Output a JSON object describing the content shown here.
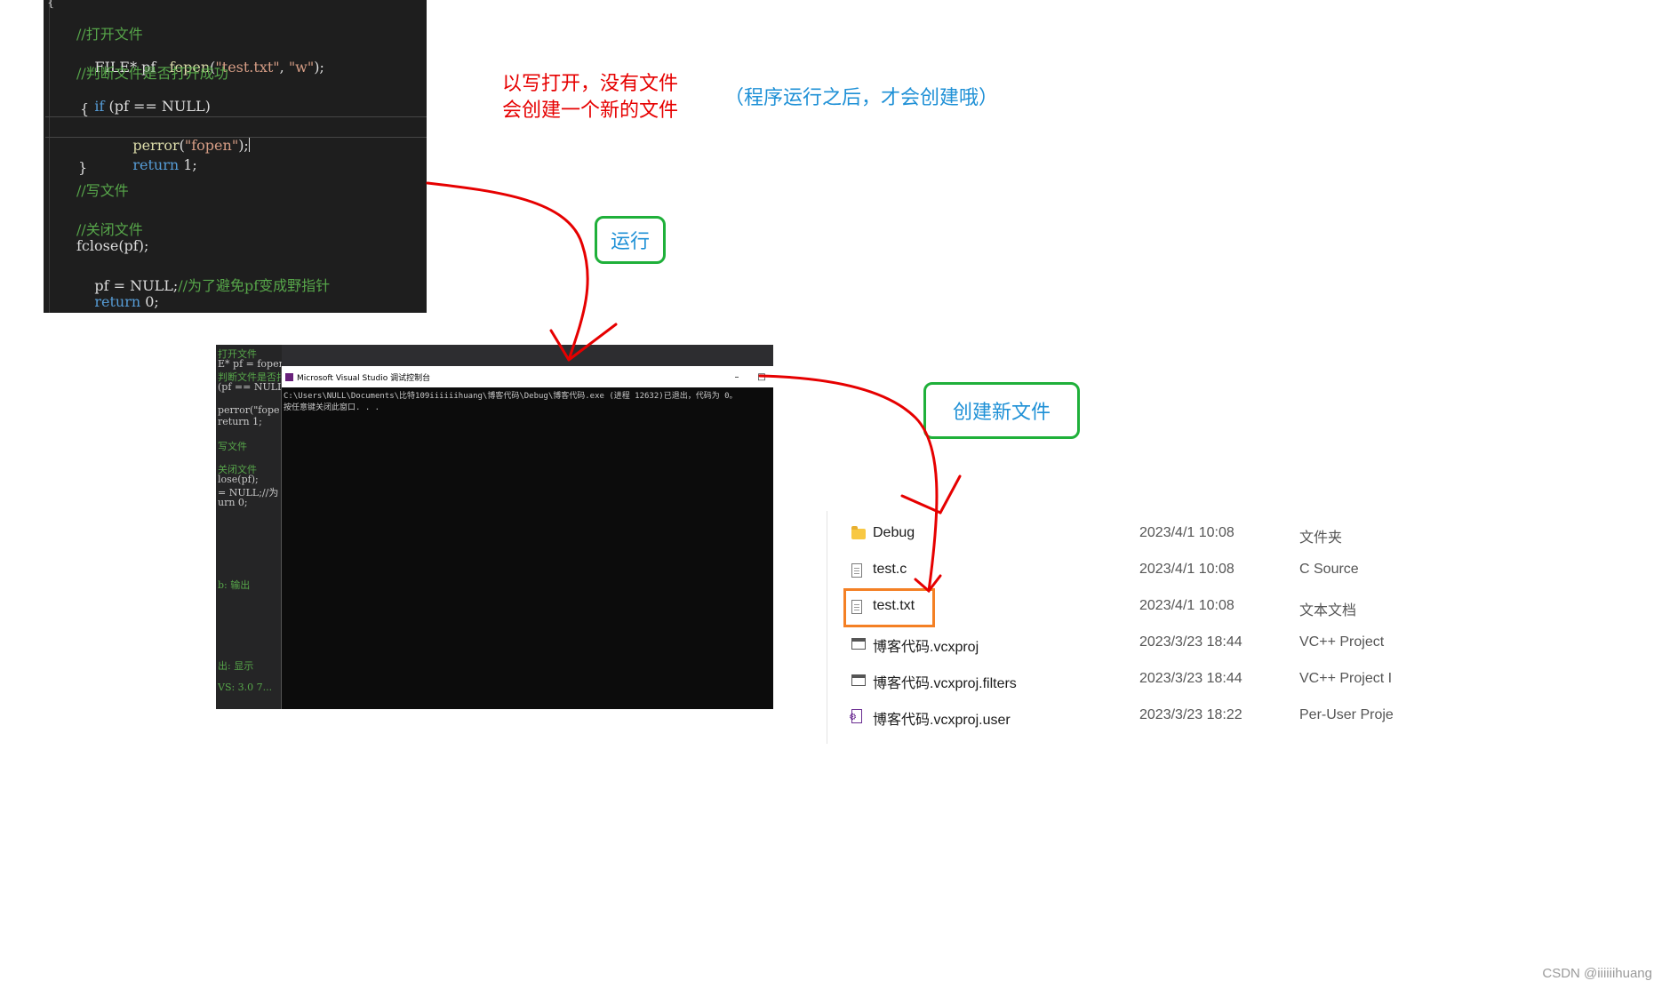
{
  "editor": {
    "brace_open": "{",
    "lines": [
      {
        "cls": "cm",
        "text": "//打开文件"
      },
      {
        "cls": "mixed_fopen"
      },
      {
        "cls": "cm",
        "text": "//判断文件是否打开成功"
      },
      {
        "cls": "mixed_if"
      },
      {
        "cls": "plain",
        "text": "{"
      },
      {
        "cls": "mixed_perror"
      },
      {
        "cls": "mixed_return1"
      },
      {
        "cls": "plain",
        "text": "}"
      },
      {
        "cls": "cm",
        "text": "//写文件"
      },
      {
        "cls": "cm",
        "text": "//关闭文件"
      },
      {
        "cls": "plain",
        "text": "fclose(pf);"
      },
      {
        "cls": "mixed_null"
      },
      {
        "cls": "mixed_return0"
      }
    ],
    "fopen_line": {
      "a": "FILE* pf   ",
      "fn": "fopen",
      "b": "(",
      "str1": "\"test.txt\"",
      "c": ", ",
      "str2": "\"w\"",
      "d": ");"
    },
    "if_line": {
      "kw": "if",
      "rest": " (pf == NULL)"
    },
    "perror_line": {
      "fn": "perror",
      "a": "(",
      "str": "\"fopen\"",
      "b": ");"
    },
    "return1_line": {
      "kw": "return",
      "rest": " 1;"
    },
    "null_line": {
      "a": "pf = NULL;",
      "cm": "//为了避免pf变成野指针"
    },
    "return0_line": {
      "kw": "return",
      "rest": " 0;"
    }
  },
  "annotations": {
    "red_line1": "以写打开，没有文件",
    "red_line2": "会创建一个新的文件",
    "blue_note": "（程序运行之后，才会创建哦）",
    "run_label": "运行",
    "create_label": "创建新文件"
  },
  "console": {
    "bg_code": [
      "打开文件",
      "E* pf = fopen",
      "判断文件是否打",
      "(pf == NULL)",
      "",
      "perror(\"fope",
      "return 1;",
      "",
      "写文件",
      "",
      "关闭文件",
      "lose(pf);",
      "= NULL;//为",
      "urn 0;",
      "",
      "",
      "",
      "",
      "",
      "",
      "b: 输出",
      "",
      "",
      "",
      "",
      "",
      "",
      "出: 显示",
      "",
      "VS: 3.0 7..."
    ],
    "title": "Microsoft Visual Studio 调试控制台",
    "minimize": "–",
    "maximize": "□",
    "output_line1": "C:\\Users\\NULL\\Documents\\比特109iiiiiihuang\\博客代码\\Debug\\博客代码.exe (进程 12632)已退出，代码为 0。",
    "output_line2": "按任意键关闭此窗口. . ."
  },
  "explorer": {
    "files": [
      {
        "icon": "folder-icon",
        "name": "Debug",
        "date": "2023/4/1 10:08",
        "type": "文件夹"
      },
      {
        "icon": "c-source-icon",
        "name": "test.c",
        "date": "2023/4/1 10:08",
        "type": "C Source"
      },
      {
        "icon": "text-document-icon",
        "name": "test.txt",
        "date": "2023/4/1 10:08",
        "type": "文本文档"
      },
      {
        "icon": "vcxproj-icon",
        "name": "博客代码.vcxproj",
        "date": "2023/3/23 18:44",
        "type": "VC++ Project"
      },
      {
        "icon": "vcxproj-filters-icon",
        "name": "博客代码.vcxproj.filters",
        "date": "2023/3/23 18:44",
        "type": "VC++ Project I"
      },
      {
        "icon": "vcxproj-user-icon",
        "name": "博客代码.vcxproj.user",
        "date": "2023/3/23 18:22",
        "type": "Per-User Proje"
      }
    ]
  },
  "watermark": "CSDN @iiiiiihuang",
  "colors": {
    "arrow": "#e60000",
    "green_box": "#1fb03a",
    "highlight_box": "#f48024",
    "blue_text": "#1e90d6"
  }
}
